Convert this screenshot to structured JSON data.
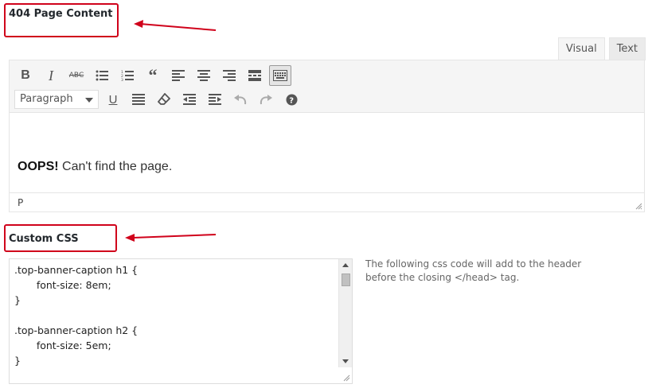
{
  "sections": {
    "page_content_label": "404 Page Content",
    "custom_css_label": "Custom CSS"
  },
  "editor": {
    "tabs": [
      {
        "label": "Visual",
        "active": true
      },
      {
        "label": "Text",
        "active": false
      }
    ],
    "toolbar_row1": [
      "bold-icon",
      "italic-icon",
      "strikethrough-icon",
      "bullet-list-icon",
      "numbered-list-icon",
      "blockquote-icon",
      "align-left-icon",
      "align-center-icon",
      "align-right-icon",
      "insert-more-icon",
      "toolbar-toggle-icon"
    ],
    "toolbar_row2": [
      "underline-icon",
      "justify-icon",
      "clear-formatting-icon",
      "outdent-icon",
      "indent-icon",
      "undo-icon",
      "redo-icon",
      "help-icon"
    ],
    "format_select": "Paragraph",
    "content_bold": "OOPS!",
    "content_text": " Can't find the page.",
    "status_path": "P"
  },
  "custom_css": {
    "code": ".top-banner-caption h1 {\n       font-size: 8em;\n}\n\n.top-banner-caption h2 {\n       font-size: 5em;\n}",
    "help_text": "The following css code will add to the header before the closing </head> tag."
  },
  "colors": {
    "annotation": "#d0021b",
    "toolbar_bg": "#f5f5f5",
    "border": "#e5e5e5"
  }
}
